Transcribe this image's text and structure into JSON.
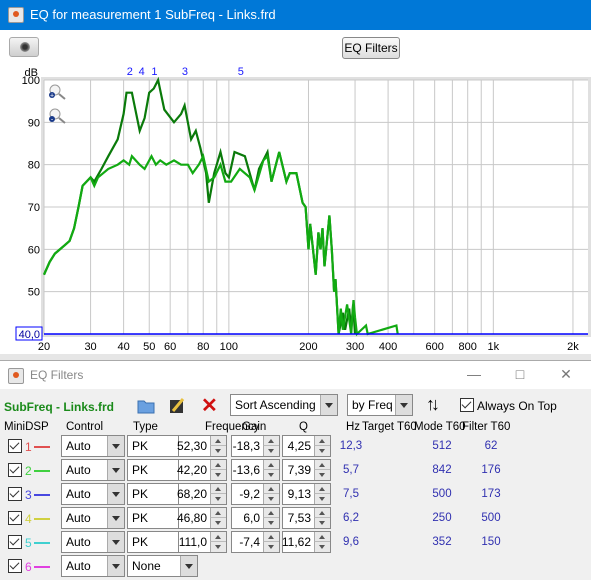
{
  "window": {
    "title": "EQ for measurement 1 SubFreq - Links.frd",
    "eq_filters_button": "EQ Filters",
    "icons": {
      "camera": "camera-icon",
      "zoom_in": "zoom-in-icon",
      "zoom_out": "zoom-out-icon"
    }
  },
  "chart_data": {
    "type": "line",
    "ylabel": "dB",
    "x_scale": "log",
    "xlim": [
      20,
      2280
    ],
    "ylim": [
      40,
      100
    ],
    "yticks": [
      "100",
      "90",
      "80",
      "70",
      "60",
      "50",
      "40,0"
    ],
    "xticks": [
      "20",
      "30",
      "40",
      "50",
      "60",
      "80",
      "100",
      "200",
      "300",
      "400",
      "600",
      "800",
      "1k",
      "2k"
    ],
    "xtick_values": [
      20,
      30,
      40,
      50,
      60,
      80,
      100,
      200,
      300,
      400,
      600,
      800,
      1000,
      2000
    ],
    "grid": true,
    "filter_markers": [
      {
        "label": "2",
        "freq": 42.2
      },
      {
        "label": "4",
        "freq": 46.8
      },
      {
        "label": "1",
        "freq": 52.3
      },
      {
        "label": "3",
        "freq": 68.2
      },
      {
        "label": "5",
        "freq": 111.0
      }
    ],
    "series": [
      {
        "color": "#0a7a0a",
        "points": [
          [
            20,
            54
          ],
          [
            21,
            57
          ],
          [
            22,
            59
          ],
          [
            24,
            61
          ],
          [
            25,
            62
          ],
          [
            26,
            65
          ],
          [
            27,
            70
          ],
          [
            28,
            75
          ],
          [
            30,
            77
          ],
          [
            31,
            76
          ],
          [
            33,
            79
          ],
          [
            35,
            82
          ],
          [
            38,
            86
          ],
          [
            40,
            92
          ],
          [
            41,
            97
          ],
          [
            43,
            97
          ],
          [
            46,
            88
          ],
          [
            48,
            91
          ],
          [
            50,
            97
          ],
          [
            52,
            98
          ],
          [
            54,
            100
          ],
          [
            57,
            93
          ],
          [
            62,
            90
          ],
          [
            66,
            92
          ],
          [
            68,
            94
          ],
          [
            72,
            86
          ],
          [
            75,
            88
          ],
          [
            78,
            84
          ],
          [
            82,
            78
          ],
          [
            84,
            71
          ],
          [
            88,
            78
          ],
          [
            93,
            83
          ],
          [
            97,
            78
          ],
          [
            100,
            77
          ],
          [
            105,
            83
          ],
          [
            115,
            82
          ],
          [
            125,
            74
          ],
          [
            130,
            79
          ],
          [
            140,
            83
          ],
          [
            145,
            76
          ],
          [
            155,
            83
          ],
          [
            165,
            76
          ],
          [
            170,
            78
          ],
          [
            180,
            78
          ],
          [
            190,
            71
          ],
          [
            195,
            70
          ],
          [
            200,
            60
          ],
          [
            203,
            66
          ],
          [
            208,
            60
          ],
          [
            213,
            54
          ],
          [
            218,
            64
          ],
          [
            222,
            60
          ],
          [
            226,
            65
          ],
          [
            230,
            56
          ],
          [
            240,
            68
          ],
          [
            245,
            60
          ],
          [
            250,
            50
          ],
          [
            253,
            53
          ],
          [
            260,
            40
          ],
          [
            270,
            45
          ],
          [
            275,
            41
          ],
          [
            285,
            46
          ],
          [
            290,
            41
          ],
          [
            295,
            47
          ],
          [
            300,
            40
          ]
        ]
      },
      {
        "color": "#12aa12",
        "points": [
          [
            20,
            54
          ],
          [
            21,
            57
          ],
          [
            22,
            59
          ],
          [
            24,
            61
          ],
          [
            25,
            62
          ],
          [
            26,
            65
          ],
          [
            27,
            70
          ],
          [
            28,
            75
          ],
          [
            30,
            77
          ],
          [
            31,
            75
          ],
          [
            32,
            77
          ],
          [
            35,
            79
          ],
          [
            38,
            80
          ],
          [
            40,
            81
          ],
          [
            42,
            80
          ],
          [
            43,
            82
          ],
          [
            46,
            80
          ],
          [
            48,
            79
          ],
          [
            51,
            82
          ],
          [
            53,
            80
          ],
          [
            55,
            81
          ],
          [
            58,
            80
          ],
          [
            62,
            81
          ],
          [
            66,
            80
          ],
          [
            70,
            80
          ],
          [
            73,
            78
          ],
          [
            77,
            80
          ],
          [
            80,
            82
          ],
          [
            84,
            76
          ],
          [
            88,
            77
          ],
          [
            93,
            80
          ],
          [
            97,
            76
          ],
          [
            102,
            76
          ],
          [
            110,
            79
          ],
          [
            120,
            77
          ],
          [
            125,
            74
          ],
          [
            135,
            81
          ],
          [
            140,
            82
          ],
          [
            145,
            76
          ],
          [
            155,
            83
          ],
          [
            165,
            76
          ],
          [
            170,
            78
          ],
          [
            180,
            78
          ],
          [
            190,
            71
          ],
          [
            195,
            70
          ],
          [
            200,
            60
          ],
          [
            203,
            66
          ],
          [
            208,
            60
          ],
          [
            213,
            54
          ],
          [
            218,
            64
          ],
          [
            222,
            60
          ],
          [
            226,
            65
          ],
          [
            230,
            56
          ],
          [
            240,
            68
          ],
          [
            245,
            60
          ],
          [
            250,
            50
          ],
          [
            253,
            53
          ],
          [
            260,
            40
          ],
          [
            265,
            46
          ],
          [
            270,
            41
          ],
          [
            280,
            47
          ],
          [
            290,
            40
          ],
          [
            296,
            48
          ],
          [
            300,
            44
          ],
          [
            305,
            40
          ],
          [
            330,
            42
          ],
          [
            335,
            40
          ],
          [
            430,
            42
          ],
          [
            435,
            40
          ]
        ]
      }
    ]
  },
  "eq": {
    "title": "EQ Filters",
    "file": "SubFreq - Links.frd",
    "sort": "Sort Ascending",
    "by": "by Freq",
    "always_on_top": "Always On Top",
    "icons": {
      "open": "folder-icon",
      "edit": "edit-icon",
      "delete": "delete-icon",
      "sort": "sort-icon"
    },
    "headers": {
      "minidsp": "MiniDSP",
      "control": "Control",
      "type": "Type",
      "frequency": "Frequency",
      "gain": "Gain",
      "q": "Q",
      "hz": "Hz",
      "target": "Target T60",
      "mode": "Mode T60",
      "filter": "Filter T60"
    },
    "rows": [
      {
        "n": "1",
        "color": "#e05050",
        "control": "Auto",
        "type": "PK",
        "freq": "52,30",
        "gain": "-18,3",
        "q": "4,25",
        "hz": "12,3",
        "mode": "512",
        "filter": "62"
      },
      {
        "n": "2",
        "color": "#40d040",
        "control": "Auto",
        "type": "PK",
        "freq": "42,20",
        "gain": "-13,6",
        "q": "7,39",
        "hz": "5,7",
        "mode": "842",
        "filter": "176"
      },
      {
        "n": "3",
        "color": "#4848e0",
        "control": "Auto",
        "type": "PK",
        "freq": "68,20",
        "gain": "-9,2",
        "q": "9,13",
        "hz": "7,5",
        "mode": "500",
        "filter": "173"
      },
      {
        "n": "4",
        "color": "#d0d040",
        "control": "Auto",
        "type": "PK",
        "freq": "46,80",
        "gain": "6,0",
        "q": "7,53",
        "hz": "6,2",
        "mode": "250",
        "filter": "500"
      },
      {
        "n": "5",
        "color": "#40d0d0",
        "control": "Auto",
        "type": "PK",
        "freq": "111,0",
        "gain": "-7,4",
        "q": "11,62",
        "hz": "9,6",
        "mode": "352",
        "filter": "150"
      },
      {
        "n": "6",
        "color": "#e040e0",
        "control": "Auto",
        "type": "None"
      }
    ]
  }
}
